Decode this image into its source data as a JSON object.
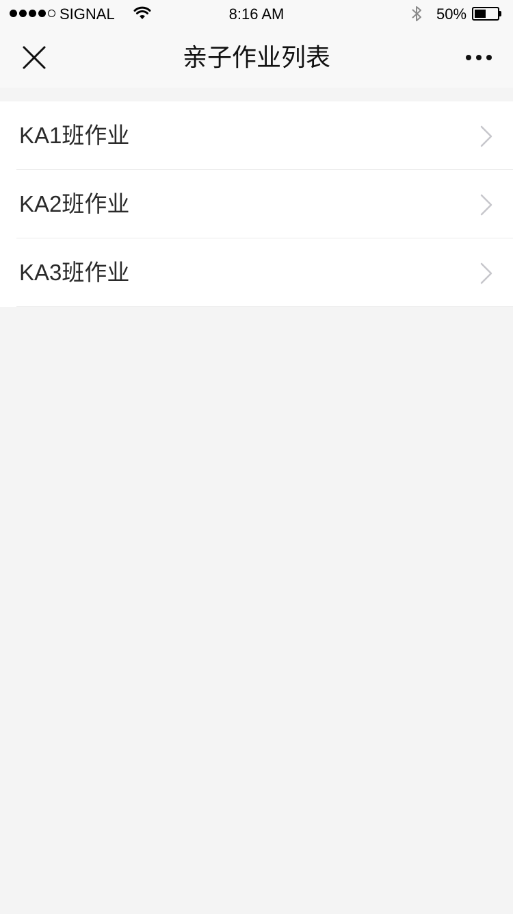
{
  "status_bar": {
    "signal_dots_filled": 4,
    "signal_dots_total": 5,
    "carrier": "SIGNAL",
    "time": "8:16 AM",
    "battery_percent_label": "50%",
    "battery_level": 0.5
  },
  "nav": {
    "title": "亲子作业列表",
    "close_icon": "close-icon",
    "more_icon": "more-dots-icon"
  },
  "list": {
    "items": [
      {
        "label": "KA1班作业",
        "icon": "chevron-right-icon"
      },
      {
        "label": "KA2班作业",
        "icon": "chevron-right-icon"
      },
      {
        "label": "KA3班作业",
        "icon": "chevron-right-icon"
      }
    ]
  },
  "colors": {
    "background": "#f4f4f4",
    "bar_background": "#f8f8f8",
    "list_background": "#ffffff",
    "chevron": "#c7c7cc",
    "divider": "#ececec"
  }
}
